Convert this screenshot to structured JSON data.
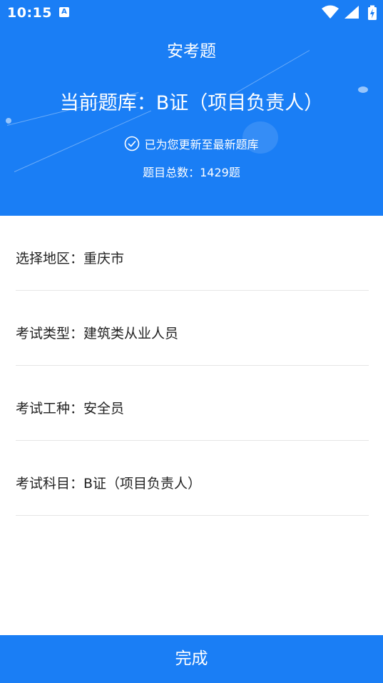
{
  "status_bar": {
    "time": "10:15",
    "notification_badge": "A",
    "icons": [
      "wifi-icon",
      "cellular-signal-icon",
      "battery-charging-icon"
    ]
  },
  "header": {
    "app_title": "安考题",
    "bank_title": "当前题库：B证（项目负责人）",
    "update_status": "已为您更新至最新题库",
    "total_questions": "题目总数：1429题",
    "background_color": "#1a7ef5"
  },
  "info": {
    "items": [
      {
        "text": "选择地区：重庆市"
      },
      {
        "text": "考试类型：建筑类从业人员"
      },
      {
        "text": "考试工种：安全员"
      },
      {
        "text": "考试科目：B证（项目负责人）"
      }
    ]
  },
  "footer": {
    "done_label": "完成",
    "accent_color": "#1a7ef5"
  }
}
